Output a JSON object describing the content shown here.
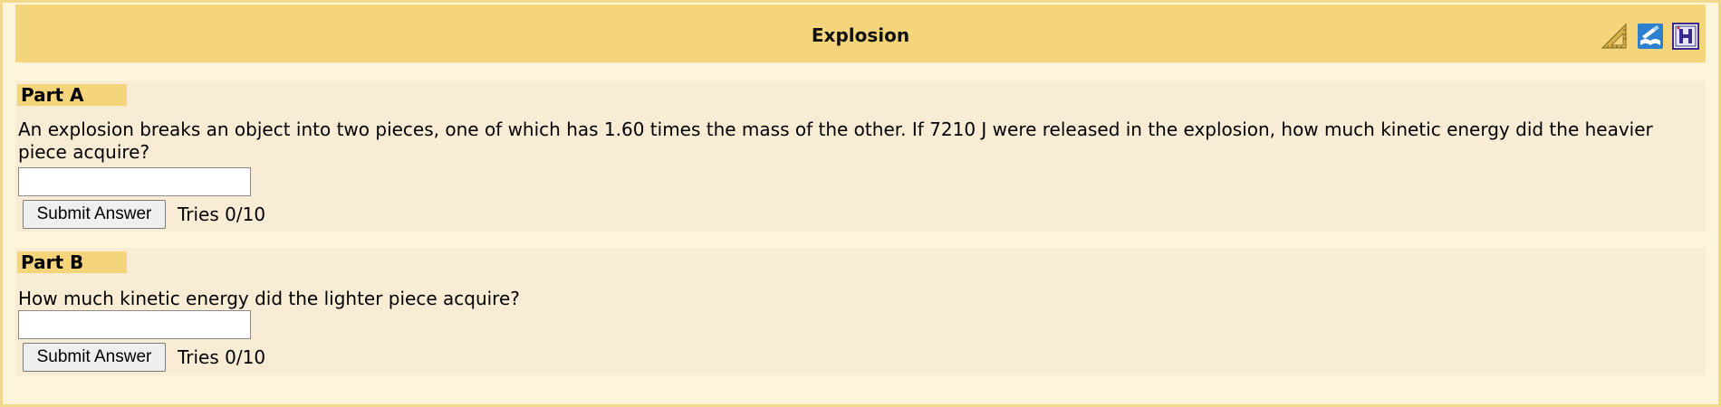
{
  "header": {
    "title": "Explosion",
    "icons": [
      "ruler-icon",
      "book-icon",
      "help-icon"
    ]
  },
  "parts": [
    {
      "label": "Part A",
      "question": "An explosion breaks an object into two pieces, one of which has 1.60 times the mass of the other. If 7210 J were released in the explosion, how much kinetic energy did the heavier piece acquire?",
      "answer_value": "",
      "submit_label": "Submit Answer",
      "tries": "Tries 0/10"
    },
    {
      "label": "Part B",
      "question": "How much kinetic energy did the lighter piece acquire?",
      "answer_value": "",
      "submit_label": "Submit Answer",
      "tries": "Tries 0/10"
    }
  ],
  "colors": {
    "header_bg": "#f5d57b",
    "page_bg": "#fdf5d9",
    "part_bg": "#f8ecd4",
    "border": "#f0d98a"
  }
}
